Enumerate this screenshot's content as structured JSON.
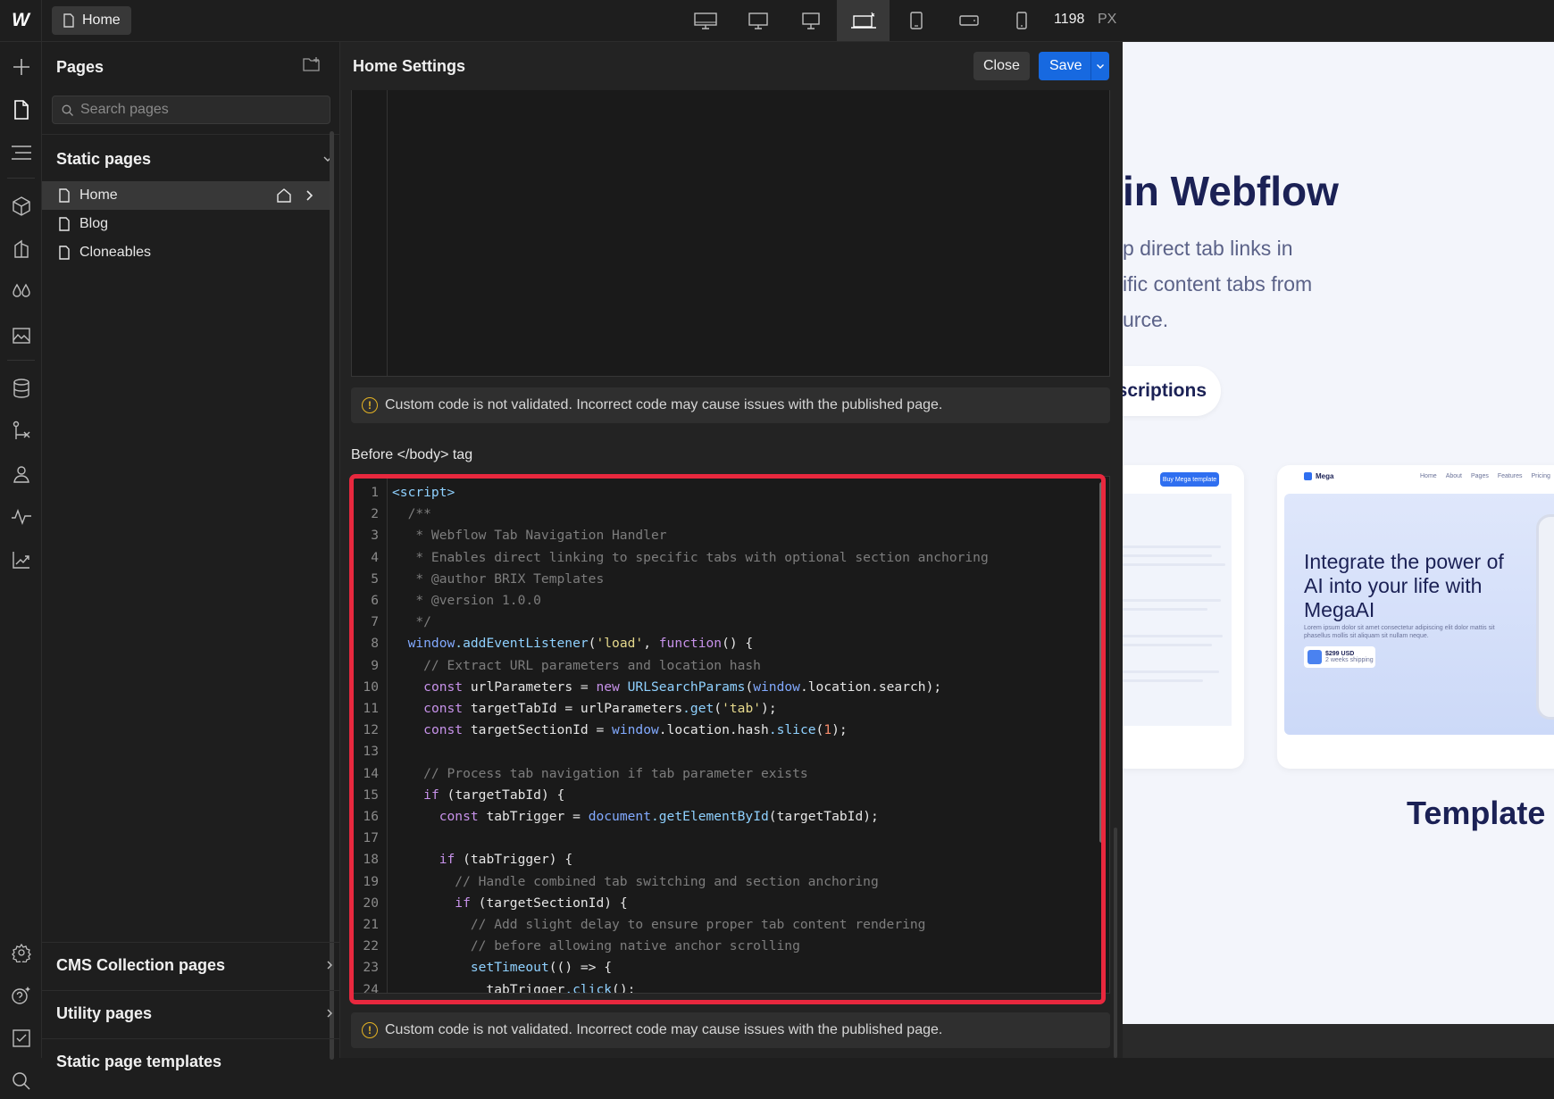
{
  "topbar": {
    "logo": "W",
    "page_chip": "Home",
    "breakpoint_width": "1198",
    "breakpoint_unit": "PX",
    "breakpoints": [
      "desktop-xxl-icon",
      "desktop-xl-icon",
      "desktop-lg-icon",
      "desktop-base-icon",
      "tablet-icon",
      "mobile-landscape-icon",
      "mobile-portrait-icon"
    ]
  },
  "pages_panel": {
    "title": "Pages",
    "search_placeholder": "Search pages",
    "static_section": "Static pages",
    "items": [
      {
        "label": "Home"
      },
      {
        "label": "Blog"
      },
      {
        "label": "Cloneables"
      }
    ],
    "cms_section": "CMS Collection pages",
    "utility_section": "Utility pages",
    "partial_section": "Static page templates"
  },
  "settings": {
    "title": "Home Settings",
    "close_label": "Close",
    "save_label": "Save",
    "warning_text": "Custom code is not validated. Incorrect code may cause issues with the published page.",
    "warning_text_2": "Custom code is not validated. Incorrect code may cause issues with the published page.",
    "before_body_label": "Before </body> tag"
  },
  "code_lines": [
    {
      "n": "1",
      "t": "<script>"
    },
    {
      "n": "2",
      "t": "  /**"
    },
    {
      "n": "3",
      "t": "   * Webflow Tab Navigation Handler"
    },
    {
      "n": "4",
      "t": "   * Enables direct linking to specific tabs with optional section anchoring"
    },
    {
      "n": "5",
      "t": "   * @author BRIX Templates"
    },
    {
      "n": "6",
      "t": "   * @version 1.0.0"
    },
    {
      "n": "7",
      "t": "   */"
    },
    {
      "n": "8",
      "t": "  window.addEventListener('load', function() {"
    },
    {
      "n": "9",
      "t": "    // Extract URL parameters and location hash"
    },
    {
      "n": "10",
      "t": "    const urlParameters = new URLSearchParams(window.location.search);"
    },
    {
      "n": "11",
      "t": "    const targetTabId = urlParameters.get('tab');"
    },
    {
      "n": "12",
      "t": "    const targetSectionId = window.location.hash.slice(1);"
    },
    {
      "n": "13",
      "t": ""
    },
    {
      "n": "14",
      "t": "    // Process tab navigation if tab parameter exists"
    },
    {
      "n": "15",
      "t": "    if (targetTabId) {"
    },
    {
      "n": "16",
      "t": "      const tabTrigger = document.getElementById(targetTabId);"
    },
    {
      "n": "17",
      "t": ""
    },
    {
      "n": "18",
      "t": "      if (tabTrigger) {"
    },
    {
      "n": "19",
      "t": "        // Handle combined tab switching and section anchoring"
    },
    {
      "n": "20",
      "t": "        if (targetSectionId) {"
    },
    {
      "n": "21",
      "t": "          // Add slight delay to ensure proper tab content rendering"
    },
    {
      "n": "22",
      "t": "          // before allowing native anchor scrolling"
    },
    {
      "n": "23",
      "t": "          setTimeout(() => {"
    },
    {
      "n": "24",
      "t": "            tabTrigger.click();"
    }
  ],
  "canvas": {
    "heading": "in Webflow",
    "sub_lines": [
      "p direct tab links in",
      "ific content tabs from",
      "urce."
    ],
    "pill": "scriptions",
    "card1_button": "Buy Mega template",
    "card2_brand": "Mega",
    "card2_nav": [
      "Home",
      "About",
      "Pages",
      "Features",
      "Pricing"
    ],
    "card2_title": "Integrate the power of AI into your life with MegaAI",
    "card2_body": "Lorem ipsum dolor sit amet consectetur adipiscing elit dolor mattis sit phasellus mollis sit aliquam sit nullam neque.",
    "card2_price": "$299 USD",
    "card2_shipping": "2 weeks shipping",
    "template_text": "Template"
  },
  "colors": {
    "accent": "#1769e0",
    "highlight": "#e8283e",
    "warning": "#e5b323",
    "canvas_heading": "#1b2155"
  }
}
